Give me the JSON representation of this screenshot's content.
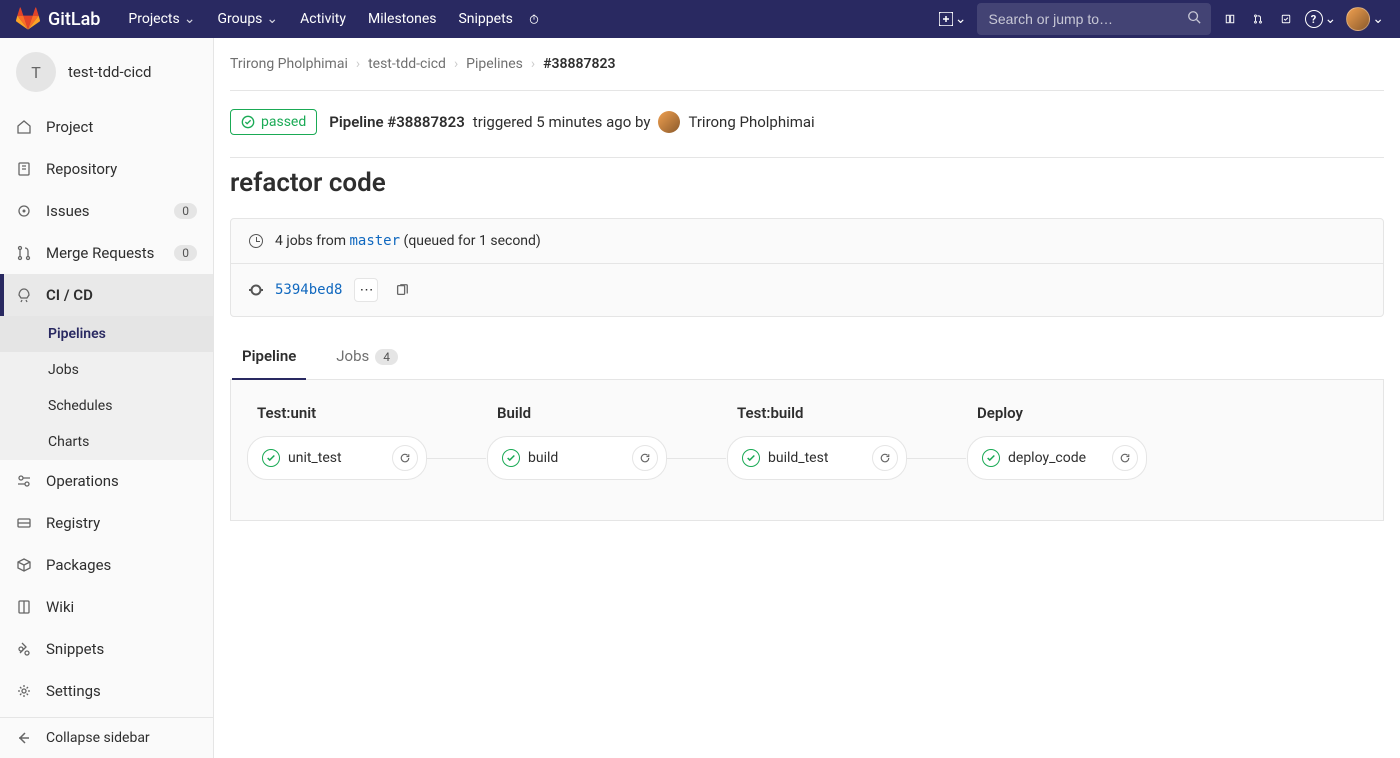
{
  "navbar": {
    "brand": "GitLab",
    "items": [
      "Projects",
      "Groups",
      "Activity",
      "Milestones",
      "Snippets"
    ],
    "search_placeholder": "Search or jump to…"
  },
  "sidebar": {
    "project_initial": "T",
    "project_name": "test-tdd-cicd",
    "items": [
      {
        "label": "Project",
        "icon": "home"
      },
      {
        "label": "Repository",
        "icon": "repo"
      },
      {
        "label": "Issues",
        "icon": "issues",
        "badge": "0"
      },
      {
        "label": "Merge Requests",
        "icon": "merge",
        "badge": "0"
      },
      {
        "label": "CI / CD",
        "icon": "rocket",
        "active": true,
        "sub": [
          {
            "label": "Pipelines",
            "active": true
          },
          {
            "label": "Jobs"
          },
          {
            "label": "Schedules"
          },
          {
            "label": "Charts"
          }
        ]
      },
      {
        "label": "Operations",
        "icon": "ops"
      },
      {
        "label": "Registry",
        "icon": "registry"
      },
      {
        "label": "Packages",
        "icon": "packages"
      },
      {
        "label": "Wiki",
        "icon": "wiki"
      },
      {
        "label": "Snippets",
        "icon": "snippets"
      },
      {
        "label": "Settings",
        "icon": "settings"
      }
    ],
    "collapse": "Collapse sidebar"
  },
  "breadcrumbs": [
    "Trirong Pholphimai",
    "test-tdd-cicd",
    "Pipelines",
    "#38887823"
  ],
  "pipeline": {
    "status": "passed",
    "title_strong": "Pipeline #38887823",
    "title_rest": "triggered 5 minutes ago by",
    "user": "Trirong Pholphimai",
    "page_title": "refactor code",
    "jobs_line_pre": "4 jobs from",
    "branch": "master",
    "jobs_line_post": "(queued for 1 second)",
    "commit_sha": "5394bed8",
    "tabs": {
      "pipeline": "Pipeline",
      "jobs": "Jobs",
      "jobs_count": "4"
    },
    "stages": [
      {
        "name": "Test:unit",
        "job": "unit_test"
      },
      {
        "name": "Build",
        "job": "build"
      },
      {
        "name": "Test:build",
        "job": "build_test"
      },
      {
        "name": "Deploy",
        "job": "deploy_code"
      }
    ]
  }
}
